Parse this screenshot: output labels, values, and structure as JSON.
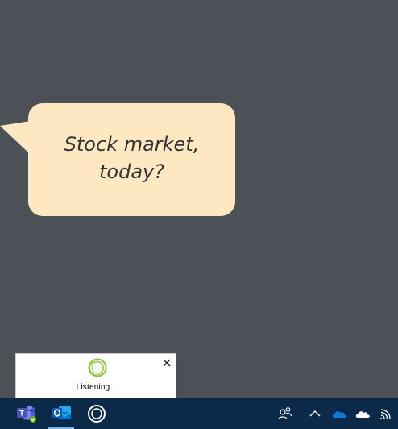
{
  "bubble": {
    "text": "Stock market, today?"
  },
  "cortana_popup": {
    "status": "Listening..."
  },
  "taskbar": {
    "pinned_apps": [
      {
        "name": "teams-icon",
        "app": "Microsoft Teams"
      },
      {
        "name": "outlook-icon",
        "app": "Outlook",
        "active": true
      },
      {
        "name": "cortana-icon",
        "app": "Cortana"
      }
    ],
    "tray": [
      "people-icon",
      "chevron-up-icon",
      "onedrive-icon",
      "onedrive-personal-icon",
      "network-icon"
    ]
  },
  "colors": {
    "desktop": "#4b5157",
    "bubble": "#fde8c1",
    "taskbar": "#0b2a4a",
    "cortana_ring": "#8cc63f"
  }
}
